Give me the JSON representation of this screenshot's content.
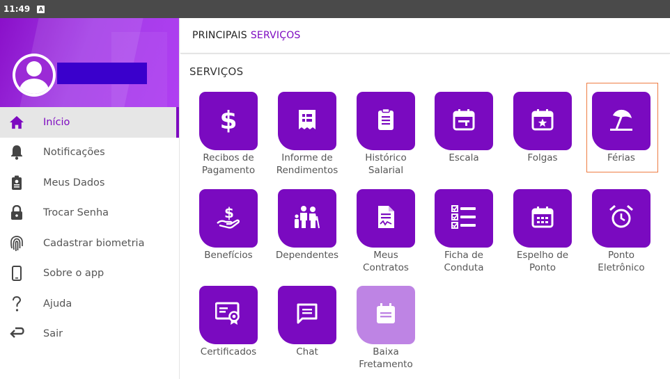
{
  "status_bar": {
    "time": "11:49",
    "notification_glyph": "A"
  },
  "drawer": {
    "user_name": "",
    "items": [
      {
        "label": "Início",
        "icon": "home-icon",
        "active": true
      },
      {
        "label": "Notificações",
        "icon": "bell-icon",
        "active": false
      },
      {
        "label": "Meus Dados",
        "icon": "badge-icon",
        "active": false
      },
      {
        "label": "Trocar Senha",
        "icon": "lock-icon",
        "active": false
      },
      {
        "label": "Cadastrar biometria",
        "icon": "fingerprint-icon",
        "active": false
      },
      {
        "label": "Sobre o app",
        "icon": "phone-icon",
        "active": false
      },
      {
        "label": "Ajuda",
        "icon": "help-icon",
        "active": false
      },
      {
        "label": "Sair",
        "icon": "logout-icon",
        "active": false
      }
    ]
  },
  "header": {
    "title_part1": "PRINCIPAIS",
    "title_part2": "SERVIÇOS"
  },
  "main": {
    "section_title": "SERVIÇOS",
    "tiles": [
      {
        "label": "Recibos de\nPagamento",
        "icon": "dollar-icon"
      },
      {
        "label": "Informe de\nRendimentos",
        "icon": "receipt-icon"
      },
      {
        "label": "Histórico\nSalarial",
        "icon": "clipboard-icon"
      },
      {
        "label": "Escala",
        "icon": "calendar-icon"
      },
      {
        "label": "Folgas",
        "icon": "calendar-star-icon"
      },
      {
        "label": "Férias",
        "icon": "beach-umbrella-icon",
        "highlighted": true
      },
      {
        "label": "Benefícios",
        "icon": "hand-dollar-icon"
      },
      {
        "label": "Dependentes",
        "icon": "family-icon"
      },
      {
        "label": "Meus\nContratos",
        "icon": "contract-icon"
      },
      {
        "label": "Ficha de\nConduta",
        "icon": "checklist-icon"
      },
      {
        "label": "Espelho de\nPonto",
        "icon": "calendar-grid-icon"
      },
      {
        "label": "Ponto\nEletrônico",
        "icon": "alarm-clock-icon"
      },
      {
        "label": "Certificados",
        "icon": "certificate-icon"
      },
      {
        "label": "Chat",
        "icon": "chat-icon"
      },
      {
        "label": "Baixa\nFretamento",
        "icon": "calendar-note-icon",
        "disabled": true
      }
    ]
  },
  "colors": {
    "primary": "#7a0ac0",
    "disabled_tile": "#be84e4",
    "highlight_border": "#ee7c42"
  }
}
